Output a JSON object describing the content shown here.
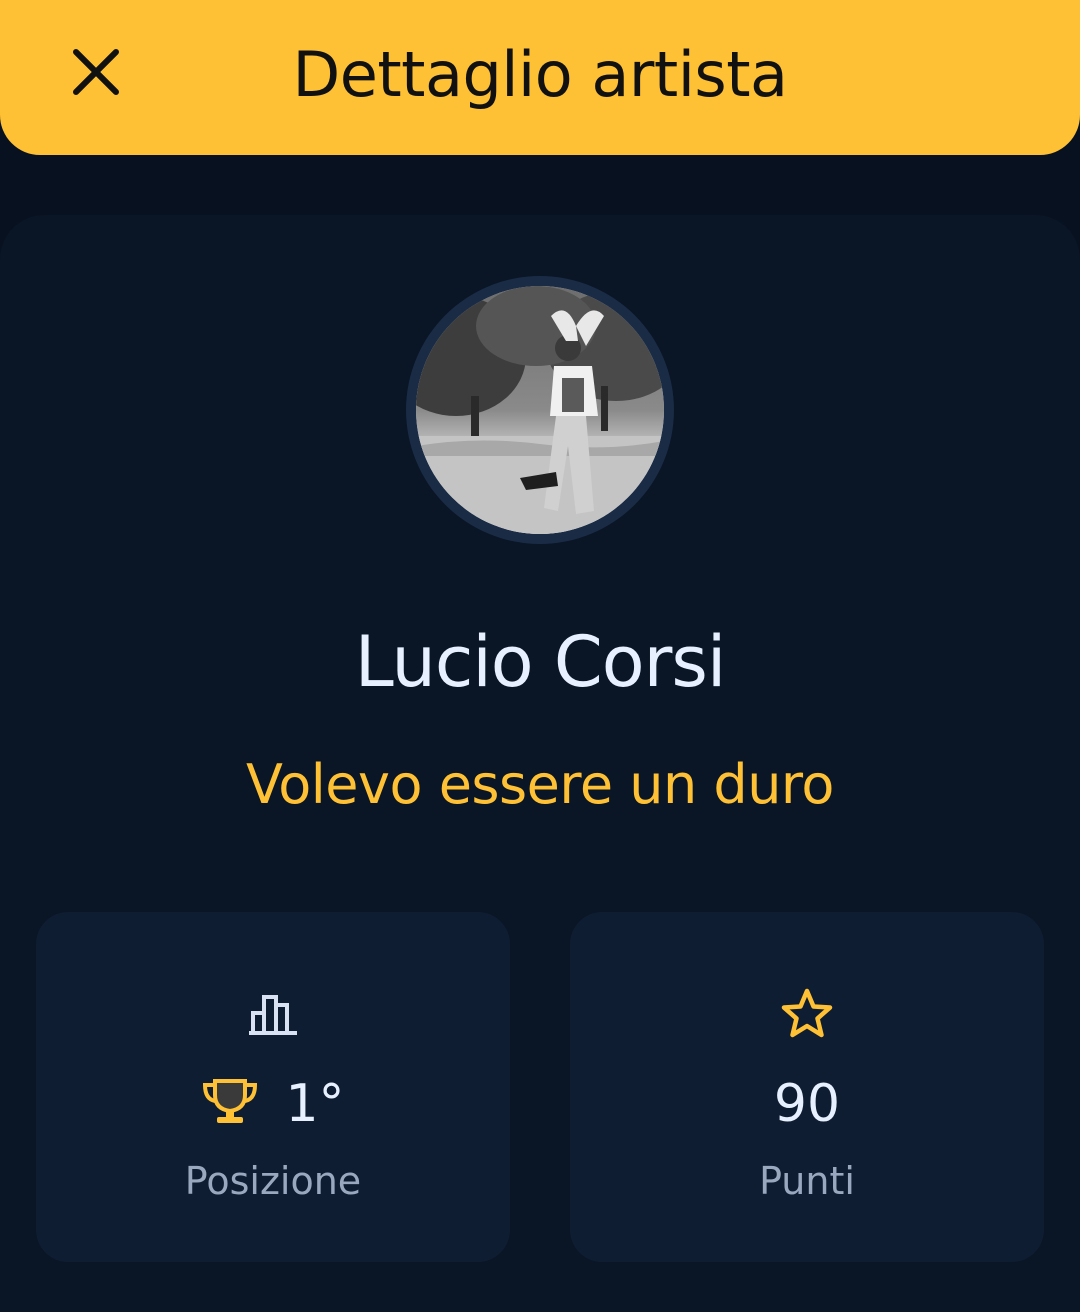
{
  "header": {
    "title": "Dettaglio artista",
    "close_icon": "close-icon",
    "background_color": "#fec034"
  },
  "artist": {
    "name": "Lucio Corsi",
    "song": "Volevo essere un duro",
    "photo": "black-and-white photo of artist jumping in a field, arms above head"
  },
  "stats": {
    "position": {
      "icon": "bar-chart-icon",
      "value_icon": "trophy-icon",
      "value": "1°",
      "label": "Posizione"
    },
    "points": {
      "icon": "star-icon",
      "value": "90",
      "label": "Punti"
    }
  },
  "colors": {
    "accent": "#fec034",
    "background": "#08111f",
    "card": "#0a1525",
    "stat_card": "#0f1d32",
    "text_primary": "#e6f0ff",
    "text_secondary": "#9aa8bf"
  }
}
